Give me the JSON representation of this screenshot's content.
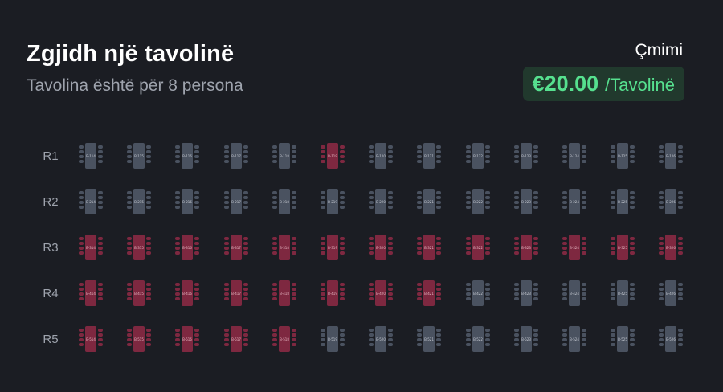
{
  "header": {
    "title": "Zgjidh një tavolinë",
    "subtitle": "Tavolina është për 8 persona"
  },
  "price": {
    "label": "Çmimi",
    "amount": "€20.00",
    "unit": "/Tavolinë"
  },
  "colors": {
    "background": "#1b1d23",
    "available": "#4a5260",
    "booked": "#7e2840",
    "price_accent": "#56e08f",
    "price_bg": "#21392d"
  },
  "rows": [
    {
      "label": "R1",
      "tables": [
        {
          "id": "B-114",
          "status": "available"
        },
        {
          "id": "B-115",
          "status": "available"
        },
        {
          "id": "B-116",
          "status": "available"
        },
        {
          "id": "B-117",
          "status": "available"
        },
        {
          "id": "B-118",
          "status": "available"
        },
        {
          "id": "B-119",
          "status": "booked"
        },
        {
          "id": "B-120",
          "status": "available"
        },
        {
          "id": "B-121",
          "status": "available"
        },
        {
          "id": "B-122",
          "status": "available"
        },
        {
          "id": "B-123",
          "status": "available"
        },
        {
          "id": "B-124",
          "status": "available"
        },
        {
          "id": "B-125",
          "status": "available"
        },
        {
          "id": "B-126",
          "status": "available"
        }
      ]
    },
    {
      "label": "R2",
      "tables": [
        {
          "id": "B-214",
          "status": "available"
        },
        {
          "id": "B-215",
          "status": "available"
        },
        {
          "id": "B-216",
          "status": "available"
        },
        {
          "id": "B-217",
          "status": "available"
        },
        {
          "id": "B-218",
          "status": "available"
        },
        {
          "id": "B-219",
          "status": "available"
        },
        {
          "id": "B-220",
          "status": "available"
        },
        {
          "id": "B-221",
          "status": "available"
        },
        {
          "id": "B-222",
          "status": "available"
        },
        {
          "id": "B-223",
          "status": "available"
        },
        {
          "id": "B-224",
          "status": "available"
        },
        {
          "id": "B-225",
          "status": "available"
        },
        {
          "id": "B-226",
          "status": "available"
        }
      ]
    },
    {
      "label": "R3",
      "tables": [
        {
          "id": "B-314",
          "status": "booked"
        },
        {
          "id": "B-315",
          "status": "booked"
        },
        {
          "id": "B-316",
          "status": "booked"
        },
        {
          "id": "B-317",
          "status": "booked"
        },
        {
          "id": "B-318",
          "status": "booked"
        },
        {
          "id": "B-319",
          "status": "booked"
        },
        {
          "id": "B-320",
          "status": "booked"
        },
        {
          "id": "B-321",
          "status": "booked"
        },
        {
          "id": "B-322",
          "status": "booked"
        },
        {
          "id": "B-323",
          "status": "booked"
        },
        {
          "id": "B-324",
          "status": "booked"
        },
        {
          "id": "B-325",
          "status": "booked"
        },
        {
          "id": "B-326",
          "status": "booked"
        }
      ]
    },
    {
      "label": "R4",
      "tables": [
        {
          "id": "B-414",
          "status": "booked"
        },
        {
          "id": "B-415",
          "status": "booked"
        },
        {
          "id": "B-416",
          "status": "booked"
        },
        {
          "id": "B-417",
          "status": "booked"
        },
        {
          "id": "B-418",
          "status": "booked"
        },
        {
          "id": "B-419",
          "status": "booked"
        },
        {
          "id": "B-420",
          "status": "booked"
        },
        {
          "id": "B-421",
          "status": "booked"
        },
        {
          "id": "B-422",
          "status": "available"
        },
        {
          "id": "B-423",
          "status": "available"
        },
        {
          "id": "B-424",
          "status": "available"
        },
        {
          "id": "B-425",
          "status": "available"
        },
        {
          "id": "B-426",
          "status": "available"
        }
      ]
    },
    {
      "label": "R5",
      "tables": [
        {
          "id": "B-514",
          "status": "booked"
        },
        {
          "id": "B-515",
          "status": "booked"
        },
        {
          "id": "B-516",
          "status": "booked"
        },
        {
          "id": "B-517",
          "status": "booked"
        },
        {
          "id": "B-518",
          "status": "booked"
        },
        {
          "id": "B-519",
          "status": "available"
        },
        {
          "id": "B-520",
          "status": "available"
        },
        {
          "id": "B-521",
          "status": "available"
        },
        {
          "id": "B-522",
          "status": "available"
        },
        {
          "id": "B-523",
          "status": "available"
        },
        {
          "id": "B-524",
          "status": "available"
        },
        {
          "id": "B-525",
          "status": "available"
        },
        {
          "id": "B-526",
          "status": "available"
        }
      ]
    }
  ]
}
